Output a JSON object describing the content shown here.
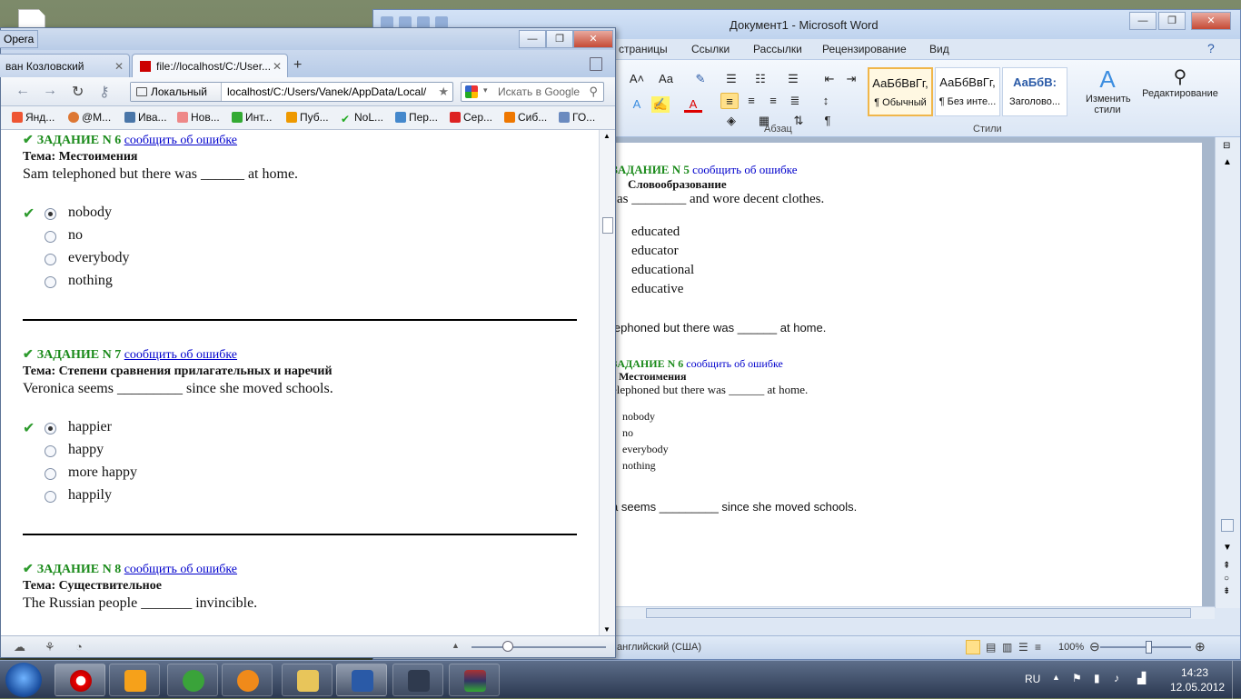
{
  "word": {
    "title": "Документ1  -  Microsoft Word",
    "tabs": [
      "страницы",
      "Ссылки",
      "Рассылки",
      "Рецензирование",
      "Вид"
    ],
    "groups": {
      "paragraph": "Абзац",
      "styles": "Стили"
    },
    "styles": [
      {
        "preview": "АаБбВвГг,",
        "name": "¶ Обычный"
      },
      {
        "preview": "АаБбВвГг,",
        "name": "¶ Без инте..."
      },
      {
        "preview": "АаБбВ:",
        "name": "Заголово..."
      }
    ],
    "change_styles": "Изменить стили",
    "editing": "Редактирование",
    "doc": {
      "t5_task": "ЗАДАНИЕ N 5",
      "t5_report": "сообщить об ошибке",
      "t5_topic": "Словообразование",
      "t5_question": "as ________ and wore decent clothes.",
      "t5_options": [
        "educated",
        "educator",
        "educational",
        "educative"
      ],
      "q_line": "lephoned but there was ______ at home.",
      "t6_task": "ЗАДАНИЕ N 6",
      "t6_report": "сообщить об ошибке",
      "t6_topic": "Местоимения",
      "t6_question": "elephoned but there was ______ at home.",
      "t6_options": [
        "nobody",
        "no",
        "everybody",
        "nothing"
      ],
      "q_line2": "a seems _________ since she moved schools."
    },
    "status": {
      "lang": "английский (США)",
      "zoom": "100%"
    }
  },
  "opera": {
    "menu_label": "Opera",
    "tab1": "ван Козловский",
    "tab2": "file://localhost/C:/User...",
    "loc_label": "Локальный",
    "url": "localhost/C:/Users/Vanek/AppData/Local/",
    "search_placeholder": "Искать в Google",
    "bookmarks": [
      "Янд...",
      "@M...",
      "Ива...",
      "Нов...",
      "Инт...",
      "Пуб...",
      "NoL...",
      "Пер...",
      "Сер...",
      "Сиб...",
      "ГО..."
    ],
    "tasks": [
      {
        "task": "ЗАДАНИЕ N 6",
        "report": "сообщить об ошибке",
        "topic": "Тема: Местоимения",
        "question": "Sam telephoned but there was ______ at home.",
        "options": [
          "nobody",
          "no",
          "everybody",
          "nothing"
        ],
        "selected": 0
      },
      {
        "task": "ЗАДАНИЕ N 7",
        "report": "сообщить об ошибке",
        "topic": "Тема: Степени сравнения прилагательных и наречий",
        "question": "Veronica seems _________ since she moved schools.",
        "options": [
          "happier",
          "happy",
          "more happy",
          "happily"
        ],
        "selected": 0
      },
      {
        "task": "ЗАДАНИЕ N 8",
        "report": "сообщить об ошибке",
        "topic": "Тема: Существительное",
        "question": "The Russian people _______ invincible."
      }
    ]
  },
  "taskbar": {
    "lang": "RU",
    "time": "14:23",
    "date": "12.05.2012"
  }
}
